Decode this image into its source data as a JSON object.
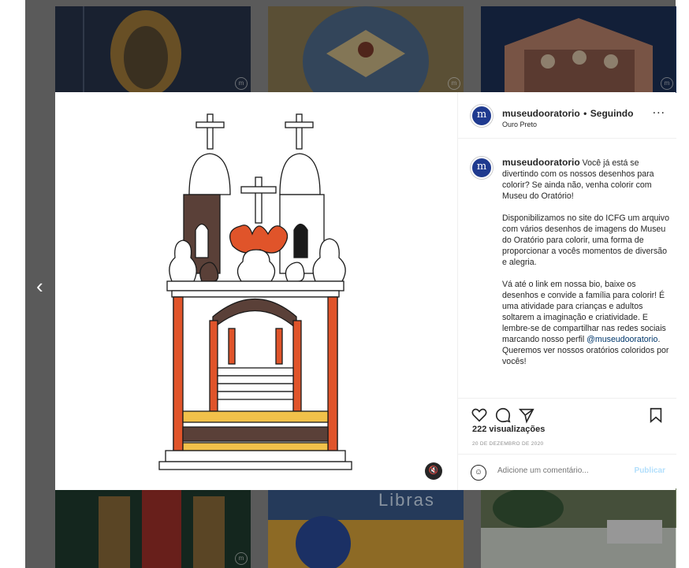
{
  "post": {
    "username": "museudooratorio",
    "separator": "•",
    "follow_status": "Seguindo",
    "location": "Ouro Preto",
    "avatar_letter": "m",
    "more_label": "..."
  },
  "caption": {
    "username": "museudooratorio",
    "p1": "Você já está se divertindo com os nossos desenhos para colorir? Se ainda não, venha colorir com Museu do Oratório!",
    "p2": "Disponibilizamos no site do ICFG um arquivo com vários desenhos de imagens do Museu do Oratório para colorir, uma forma de proporcionar a vocês momentos de diversão e alegria.",
    "p3_pre": "Vá até o link em nossa bio, baixe os desenhos e convide a família para colorir! É uma atividade para crianças e adultos soltarem a imaginação e criatividade. E lembre-se de compartilhar nas redes sociais marcando nosso perfil ",
    "p3_mention": "@museudooratorio",
    "p3_post": ". Queremos ver nossos oratórios coloridos por vocês!"
  },
  "stats": {
    "views": "222 visualizações",
    "date": "20 DE DEZEMBRO DE 2020"
  },
  "comment": {
    "placeholder": "Adicione um comentário...",
    "publish": "Publicar"
  },
  "grid": {
    "tile_text": "Libras"
  },
  "nav": {
    "prev": "‹",
    "next": "›"
  },
  "icons": [
    "heart-icon",
    "comment-icon",
    "share-icon",
    "bookmark-icon",
    "emoji-icon",
    "mute-icon",
    "more-icon"
  ],
  "colors": {
    "accent": "#e0542a",
    "brown": "#5a4038",
    "link": "#00376b",
    "avatar": "#1f3a8f"
  }
}
